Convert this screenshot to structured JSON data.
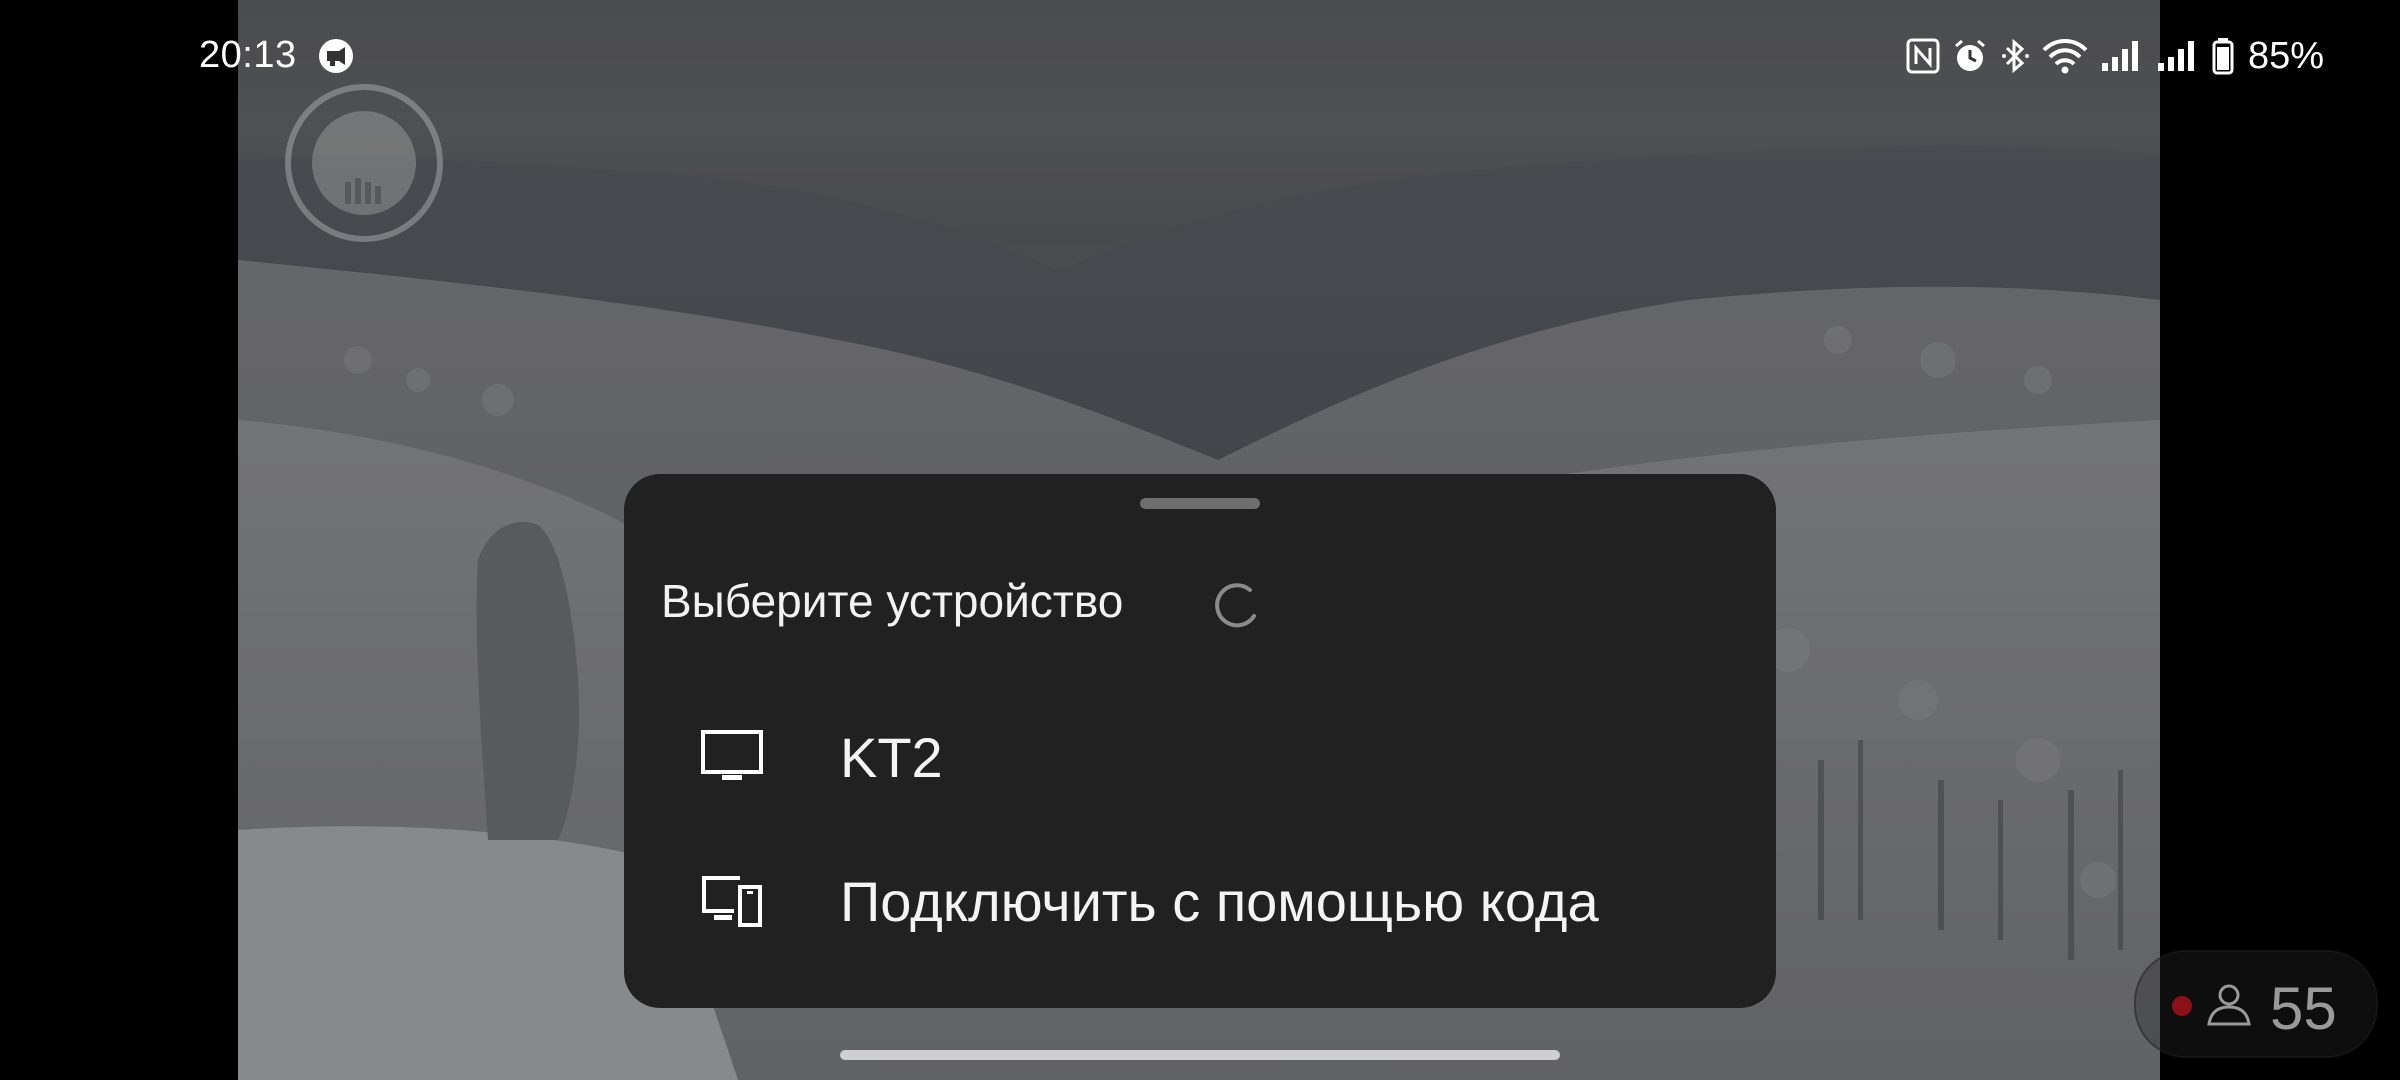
{
  "status_bar": {
    "time": "20:13",
    "battery": "85%",
    "icons": [
      "cast-icon",
      "nfc-icon",
      "alarm-icon",
      "bluetooth-icon",
      "wifi-icon",
      "signal-icon",
      "signal-icon",
      "battery-icon"
    ]
  },
  "dialog": {
    "title": "Выберите устройство",
    "loading_icon": "spinner-icon",
    "devices": [
      {
        "icon": "tv-icon",
        "label": "KT2"
      },
      {
        "icon": "devices-icon",
        "label": "Подключить с помощью кода"
      }
    ]
  },
  "viewers": {
    "count": "55",
    "icon": "person-icon",
    "live_color": "#8b1018"
  },
  "colors": {
    "sheet_background": "#212121",
    "text": "#f4f4f4"
  }
}
